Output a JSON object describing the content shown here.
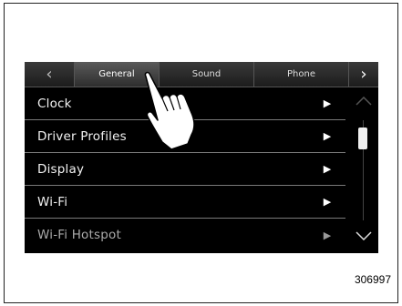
{
  "tabs": {
    "prev_arrow": "‹",
    "items": [
      {
        "label": "General",
        "active": true
      },
      {
        "label": "Sound",
        "active": false
      },
      {
        "label": "Phone",
        "active": false
      }
    ],
    "next_arrow": "›"
  },
  "menu": {
    "items": [
      {
        "label": "Clock",
        "icon": "play-arrow-icon"
      },
      {
        "label": "Driver Profiles",
        "icon": "play-arrow-icon"
      },
      {
        "label": "Display",
        "icon": "play-arrow-icon"
      },
      {
        "label": "Wi-Fi",
        "icon": "play-arrow-icon"
      },
      {
        "label": "Wi-Fi Hotspot",
        "icon": "play-arrow-icon"
      }
    ]
  },
  "scrollbar": {
    "up_icon": "chevron-up-icon",
    "down_icon": "chevron-down-icon"
  },
  "figure_id": "306997",
  "colors": {
    "screen_bg": "#000000",
    "text": "#f2f2f2",
    "divider": "#7a7a7a"
  }
}
